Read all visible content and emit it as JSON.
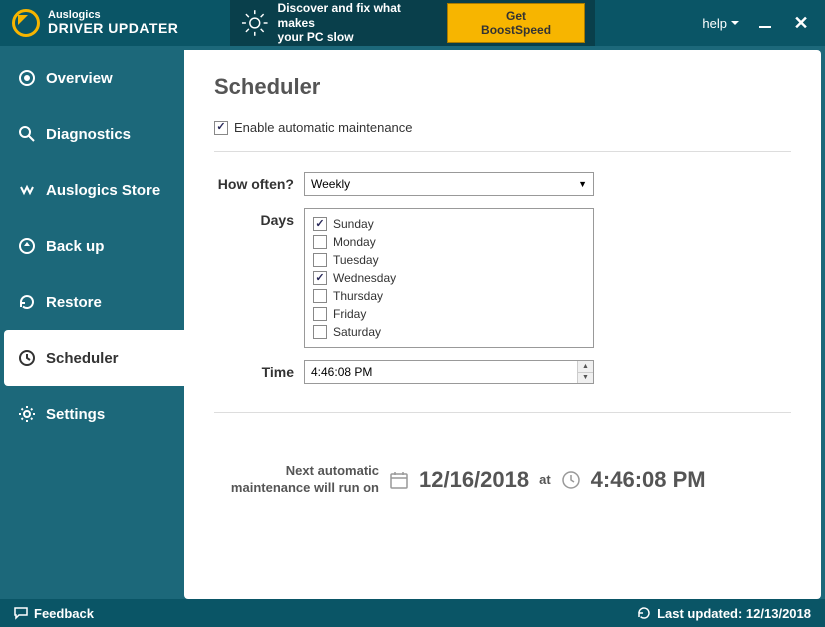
{
  "brand": "Auslogics",
  "product": "DRIVER UPDATER",
  "promo": {
    "line1": "Discover and fix what makes",
    "line2": "your PC slow",
    "button": "Get BoostSpeed"
  },
  "help": "help",
  "sidebar": {
    "items": [
      {
        "label": "Overview"
      },
      {
        "label": "Diagnostics"
      },
      {
        "label": "Auslogics Store"
      },
      {
        "label": "Back up"
      },
      {
        "label": "Restore"
      },
      {
        "label": "Scheduler"
      },
      {
        "label": "Settings"
      }
    ]
  },
  "page": {
    "title": "Scheduler",
    "enable_label": "Enable automatic maintenance",
    "how_often_label": "How often?",
    "how_often_value": "Weekly",
    "days_label": "Days",
    "days": [
      {
        "name": "Sunday",
        "checked": true
      },
      {
        "name": "Monday",
        "checked": false
      },
      {
        "name": "Tuesday",
        "checked": false
      },
      {
        "name": "Wednesday",
        "checked": true
      },
      {
        "name": "Thursday",
        "checked": false
      },
      {
        "name": "Friday",
        "checked": false
      },
      {
        "name": "Saturday",
        "checked": false
      }
    ],
    "time_label": "Time",
    "time_value": "4:46:08 PM",
    "next_label": "Next automatic maintenance will run on",
    "next_date": "12/16/2018",
    "at": "at",
    "next_time": "4:46:08 PM"
  },
  "footer": {
    "feedback": "Feedback",
    "last_updated": "Last updated: 12/13/2018"
  }
}
